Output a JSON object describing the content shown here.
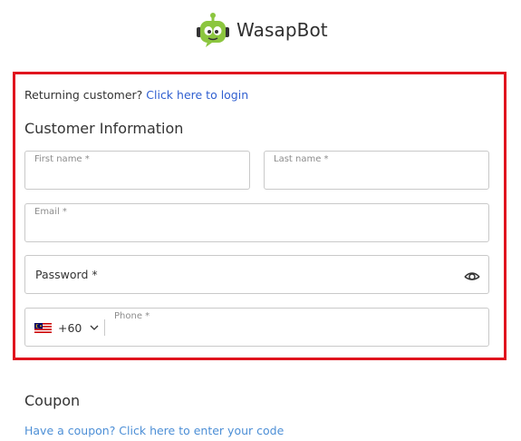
{
  "brand": {
    "name": "WasapBot"
  },
  "login_prompt": {
    "text": "Returning customer?",
    "link": "Click here to login"
  },
  "customer_info": {
    "title": "Customer Information",
    "first_name_label": "First name *",
    "last_name_label": "Last name *",
    "email_label": "Email *",
    "password_placeholder": "Password *",
    "phone": {
      "country_code": "+60",
      "label": "Phone *"
    }
  },
  "coupon": {
    "title": "Coupon",
    "link": "Have a coupon? Click here to enter your code"
  },
  "colors": {
    "highlight": "#e0141e",
    "link": "#2f5fd0",
    "coupon_link": "#4d8fd6",
    "logo_green": "#8cc63f"
  },
  "icons": [
    "robot-logo-icon",
    "eye-icon",
    "malaysia-flag-icon",
    "chevron-down-icon"
  ]
}
